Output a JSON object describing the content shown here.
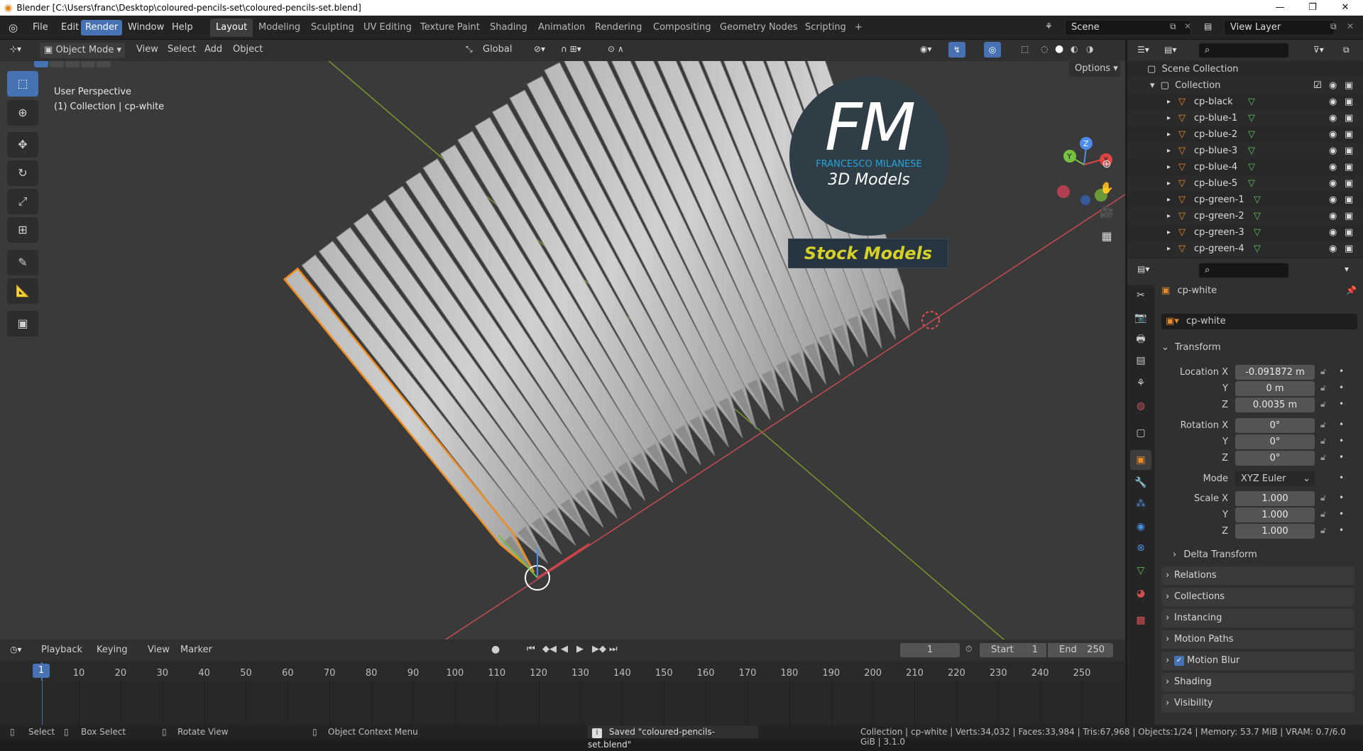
{
  "window": {
    "title": "Blender [C:\\Users\\franc\\Desktop\\coloured-pencils-set\\coloured-pencils-set.blend]"
  },
  "menu": {
    "items": [
      "File",
      "Edit",
      "Render",
      "Window",
      "Help"
    ],
    "active": "Render"
  },
  "workspaces": {
    "tabs": [
      "Layout",
      "Modeling",
      "Sculpting",
      "UV Editing",
      "Texture Paint",
      "Shading",
      "Animation",
      "Rendering",
      "Compositing",
      "Geometry Nodes",
      "Scripting"
    ],
    "active": "Layout",
    "add": "+"
  },
  "scene": {
    "name": "Scene",
    "view_layer": "View Layer"
  },
  "viewport_header": {
    "mode": "Object Mode",
    "menus": [
      "View",
      "Select",
      "Add",
      "Object"
    ],
    "orientation": "Global",
    "options": "Options"
  },
  "viewport": {
    "perspective": "User Perspective",
    "context": "(1) Collection | cp-white",
    "axes": {
      "x": "X",
      "y": "Y",
      "z": "Z"
    }
  },
  "watermark": {
    "logo": "FM",
    "name": "FRANCESCO MILANESE",
    "sub": "3D Models",
    "banner": "Stock Models"
  },
  "outliner": {
    "root": "Scene Collection",
    "collection": "Collection",
    "objects": [
      "cp-black",
      "cp-blue-1",
      "cp-blue-2",
      "cp-blue-3",
      "cp-blue-4",
      "cp-blue-5",
      "cp-green-1",
      "cp-green-2",
      "cp-green-3",
      "cp-green-4"
    ]
  },
  "properties": {
    "object_name": "cp-white",
    "data_name": "cp-white",
    "transform_label": "Transform",
    "location": {
      "label": "Location X",
      "x": "-0.091872 m",
      "y": "0 m",
      "z": "0.0035 m"
    },
    "rotation": {
      "label": "Rotation X",
      "x": "0°",
      "y": "0°",
      "z": "0°"
    },
    "mode_label": "Mode",
    "mode": "XYZ Euler",
    "scale": {
      "label": "Scale X",
      "x": "1.000",
      "y": "1.000",
      "z": "1.000"
    },
    "y": "Y",
    "z": "Z",
    "panels": [
      "Delta Transform",
      "Relations",
      "Collections",
      "Instancing",
      "Motion Paths",
      "Motion Blur",
      "Shading",
      "Visibility"
    ]
  },
  "timeline": {
    "menus": [
      "Playback",
      "Keying",
      "View",
      "Marker"
    ],
    "current_frame": "1",
    "start_label": "Start",
    "start": "1",
    "end_label": "End",
    "end": "250",
    "ticks": [
      "1",
      "10",
      "20",
      "30",
      "40",
      "50",
      "60",
      "70",
      "80",
      "90",
      "100",
      "110",
      "120",
      "130",
      "140",
      "150",
      "160",
      "170",
      "180",
      "190",
      "200",
      "210",
      "220",
      "230",
      "240",
      "250"
    ]
  },
  "statusbar": {
    "select": "Select",
    "box_select": "Box Select",
    "rotate": "Rotate View",
    "context_menu": "Object Context Menu",
    "message": "Saved \"coloured-pencils-set.blend\"",
    "stats": "Collection | cp-white | Verts:34,032 | Faces:33,984 | Tris:67,968 | Objects:1/24 | Memory: 53.7 MiB | VRAM: 0.7/6.0 GiB | 3.1.0"
  }
}
